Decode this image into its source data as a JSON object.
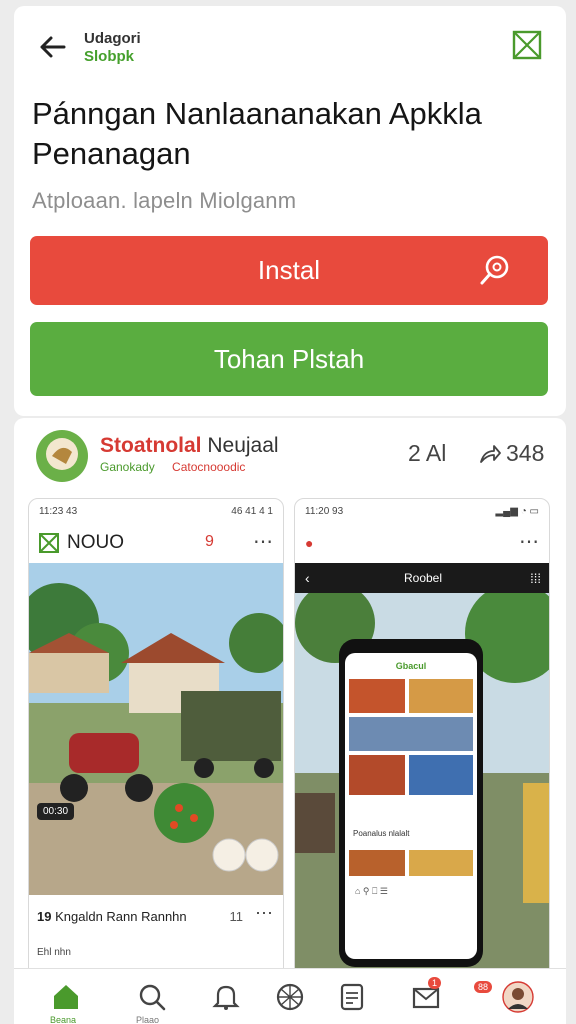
{
  "header": {
    "brand_line1": "Udagori",
    "brand_line2": "Slobpk"
  },
  "app": {
    "title": "Pánngan Nanlaananakan Apkkla Penanagan",
    "subtitle": "Atploaan. lapeln Miolganm"
  },
  "buttons": {
    "install": "Instal",
    "secondary": "Tohan Plstah"
  },
  "developer": {
    "name_red": "Stoatnolal",
    "name_dark": "Neujaal",
    "sub_left": "Ganokady",
    "sub_right": "Catocnooodic",
    "rating": "2 Al",
    "shares": "348"
  },
  "screenshot_left": {
    "status_time": "11:23 43",
    "status_right": "46 41 4 1",
    "header_title": "NOUO",
    "header_badge": "9",
    "image_badge": "00:30",
    "post_prefix": "19",
    "post_title": "Kngaldn Rann Rannhn",
    "post_count": "11",
    "footer_text": "Ehl nhn"
  },
  "screenshot_right": {
    "status_time": "11:20 93",
    "bar_title": "Roobel",
    "phone_title": "Gbacul",
    "phone_caption": "Poanalus nlalalt"
  },
  "nav": {
    "home_label": "Beana",
    "search_label": "Plaao",
    "mail_badge": "1",
    "profile_badge": "88"
  },
  "colors": {
    "primary_red": "#e84a3d",
    "primary_green": "#5aad40"
  }
}
